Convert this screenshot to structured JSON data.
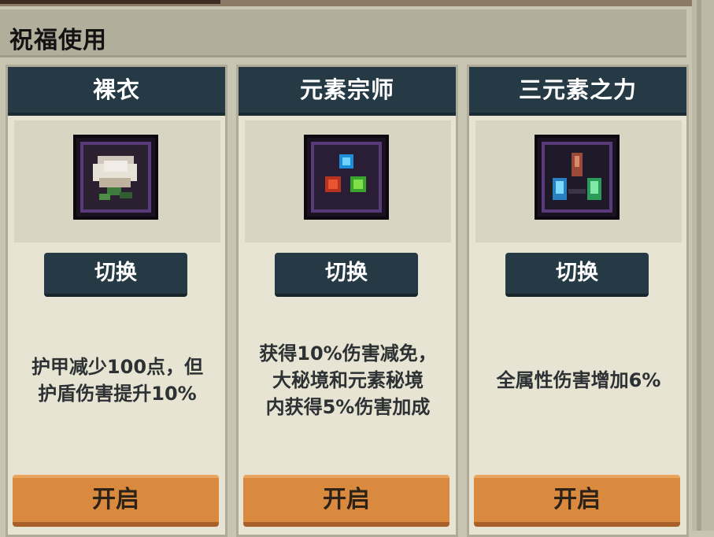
{
  "header": {
    "title": "祝福使用"
  },
  "cards": [
    {
      "title": "裸衣",
      "icon": "pale-flower-icon",
      "switch_label": "切换",
      "description": "护甲减少100点，但\n护盾伤害提升10%",
      "open_label": "开启"
    },
    {
      "title": "元素宗师",
      "icon": "element-orbs-icon",
      "switch_label": "切换",
      "description": "获得10%伤害减免，\n大秘境和元素秘境\n内获得5%伤害加成",
      "open_label": "开启"
    },
    {
      "title": "三元素之力",
      "icon": "three-element-crystals-icon",
      "switch_label": "切换",
      "description": "全属性伤害增加6%",
      "open_label": "开启"
    }
  ],
  "colors": {
    "card_header": "#253a44",
    "open_button": "#d98a3e",
    "icon_frame": "#5a3b7a"
  }
}
